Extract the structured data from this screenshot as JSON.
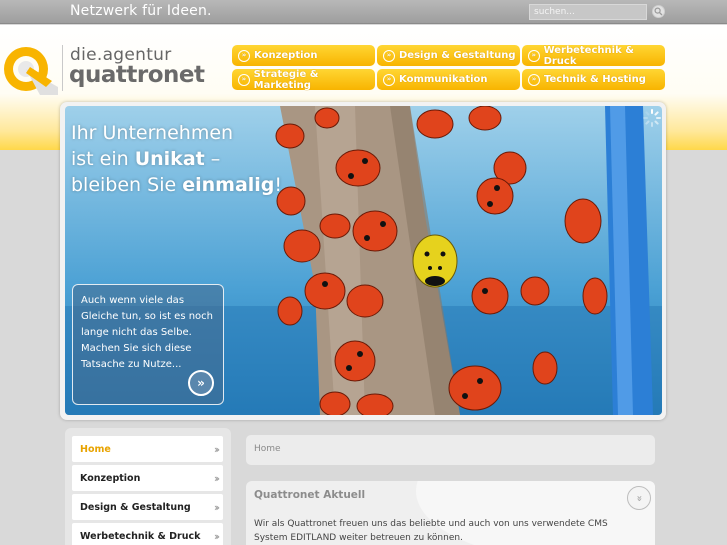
{
  "topbar": {
    "slogan": "Netzwerk für Ideen.",
    "search_placeholder": "suchen..."
  },
  "logo": {
    "line1": "die.agentur",
    "line2": "quattronet",
    "brand_color": "#f8b400"
  },
  "nav": {
    "items": [
      {
        "label": "Konzeption"
      },
      {
        "label": "Design & Gestaltung"
      },
      {
        "label": "Werbetechnik & Druck"
      },
      {
        "label": "Strategie & Marketing"
      },
      {
        "label": "Kommunikation"
      },
      {
        "label": "Technik & Hosting"
      }
    ]
  },
  "banner": {
    "headline_line1": "Ihr Unternehmen",
    "headline_line2_pre": "ist ein ",
    "headline_line2_bold": "Unikat",
    "headline_line2_post": " –",
    "headline_line3_pre": "bleiben Sie ",
    "headline_line3_bold": "einmalig",
    "headline_line3_post": "!",
    "teaser_text": "Auch wenn viele das Gleiche tun, so ist es noch lange nicht das Selbe. Machen Sie sich diese Tatsache zu Nutze..."
  },
  "sidebar": {
    "items": [
      {
        "label": "Home"
      },
      {
        "label": "Konzeption"
      },
      {
        "label": "Design & Gestaltung"
      },
      {
        "label": "Werbetechnik & Druck"
      }
    ]
  },
  "breadcrumb": {
    "current": "Home"
  },
  "news": {
    "title": "Quattronet Aktuell",
    "text": "Wir als Quattronet freuen uns das beliebte und auch von uns verwendete CMS System EDITLAND weiter betreuen zu können."
  }
}
